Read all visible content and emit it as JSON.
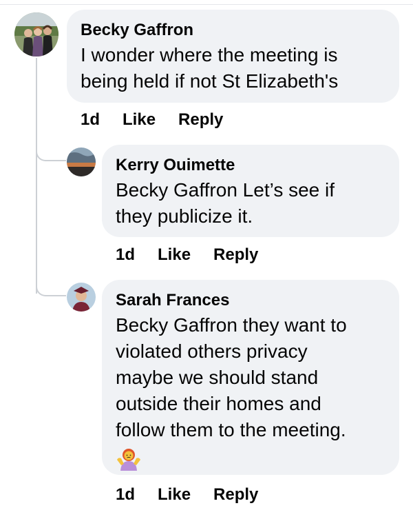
{
  "comments": [
    {
      "author": "Becky Gaffron",
      "lines": [
        "I wonder where the meeting is",
        "being held if not St Elizabeth's"
      ],
      "time": "1d",
      "like_label": "Like",
      "reply_label": "Reply"
    },
    {
      "author": "Kerry Ouimette",
      "lines": [
        "Becky Gaffron Let’s see if",
        "they publicize it."
      ],
      "time": "1d",
      "like_label": "Like",
      "reply_label": "Reply"
    },
    {
      "author": "Sarah Frances",
      "lines": [
        "Becky Gaffron they want to",
        "violated others privacy",
        "maybe we should stand",
        "outside their homes and",
        "follow them to the meeting."
      ],
      "emoji": "shrugging-woman-emoji",
      "time": "1d",
      "like_label": "Like",
      "reply_label": "Reply"
    }
  ],
  "colors": {
    "bubble": "#f0f2f5",
    "thread_line": "#ccd0d5",
    "text": "#050505"
  }
}
